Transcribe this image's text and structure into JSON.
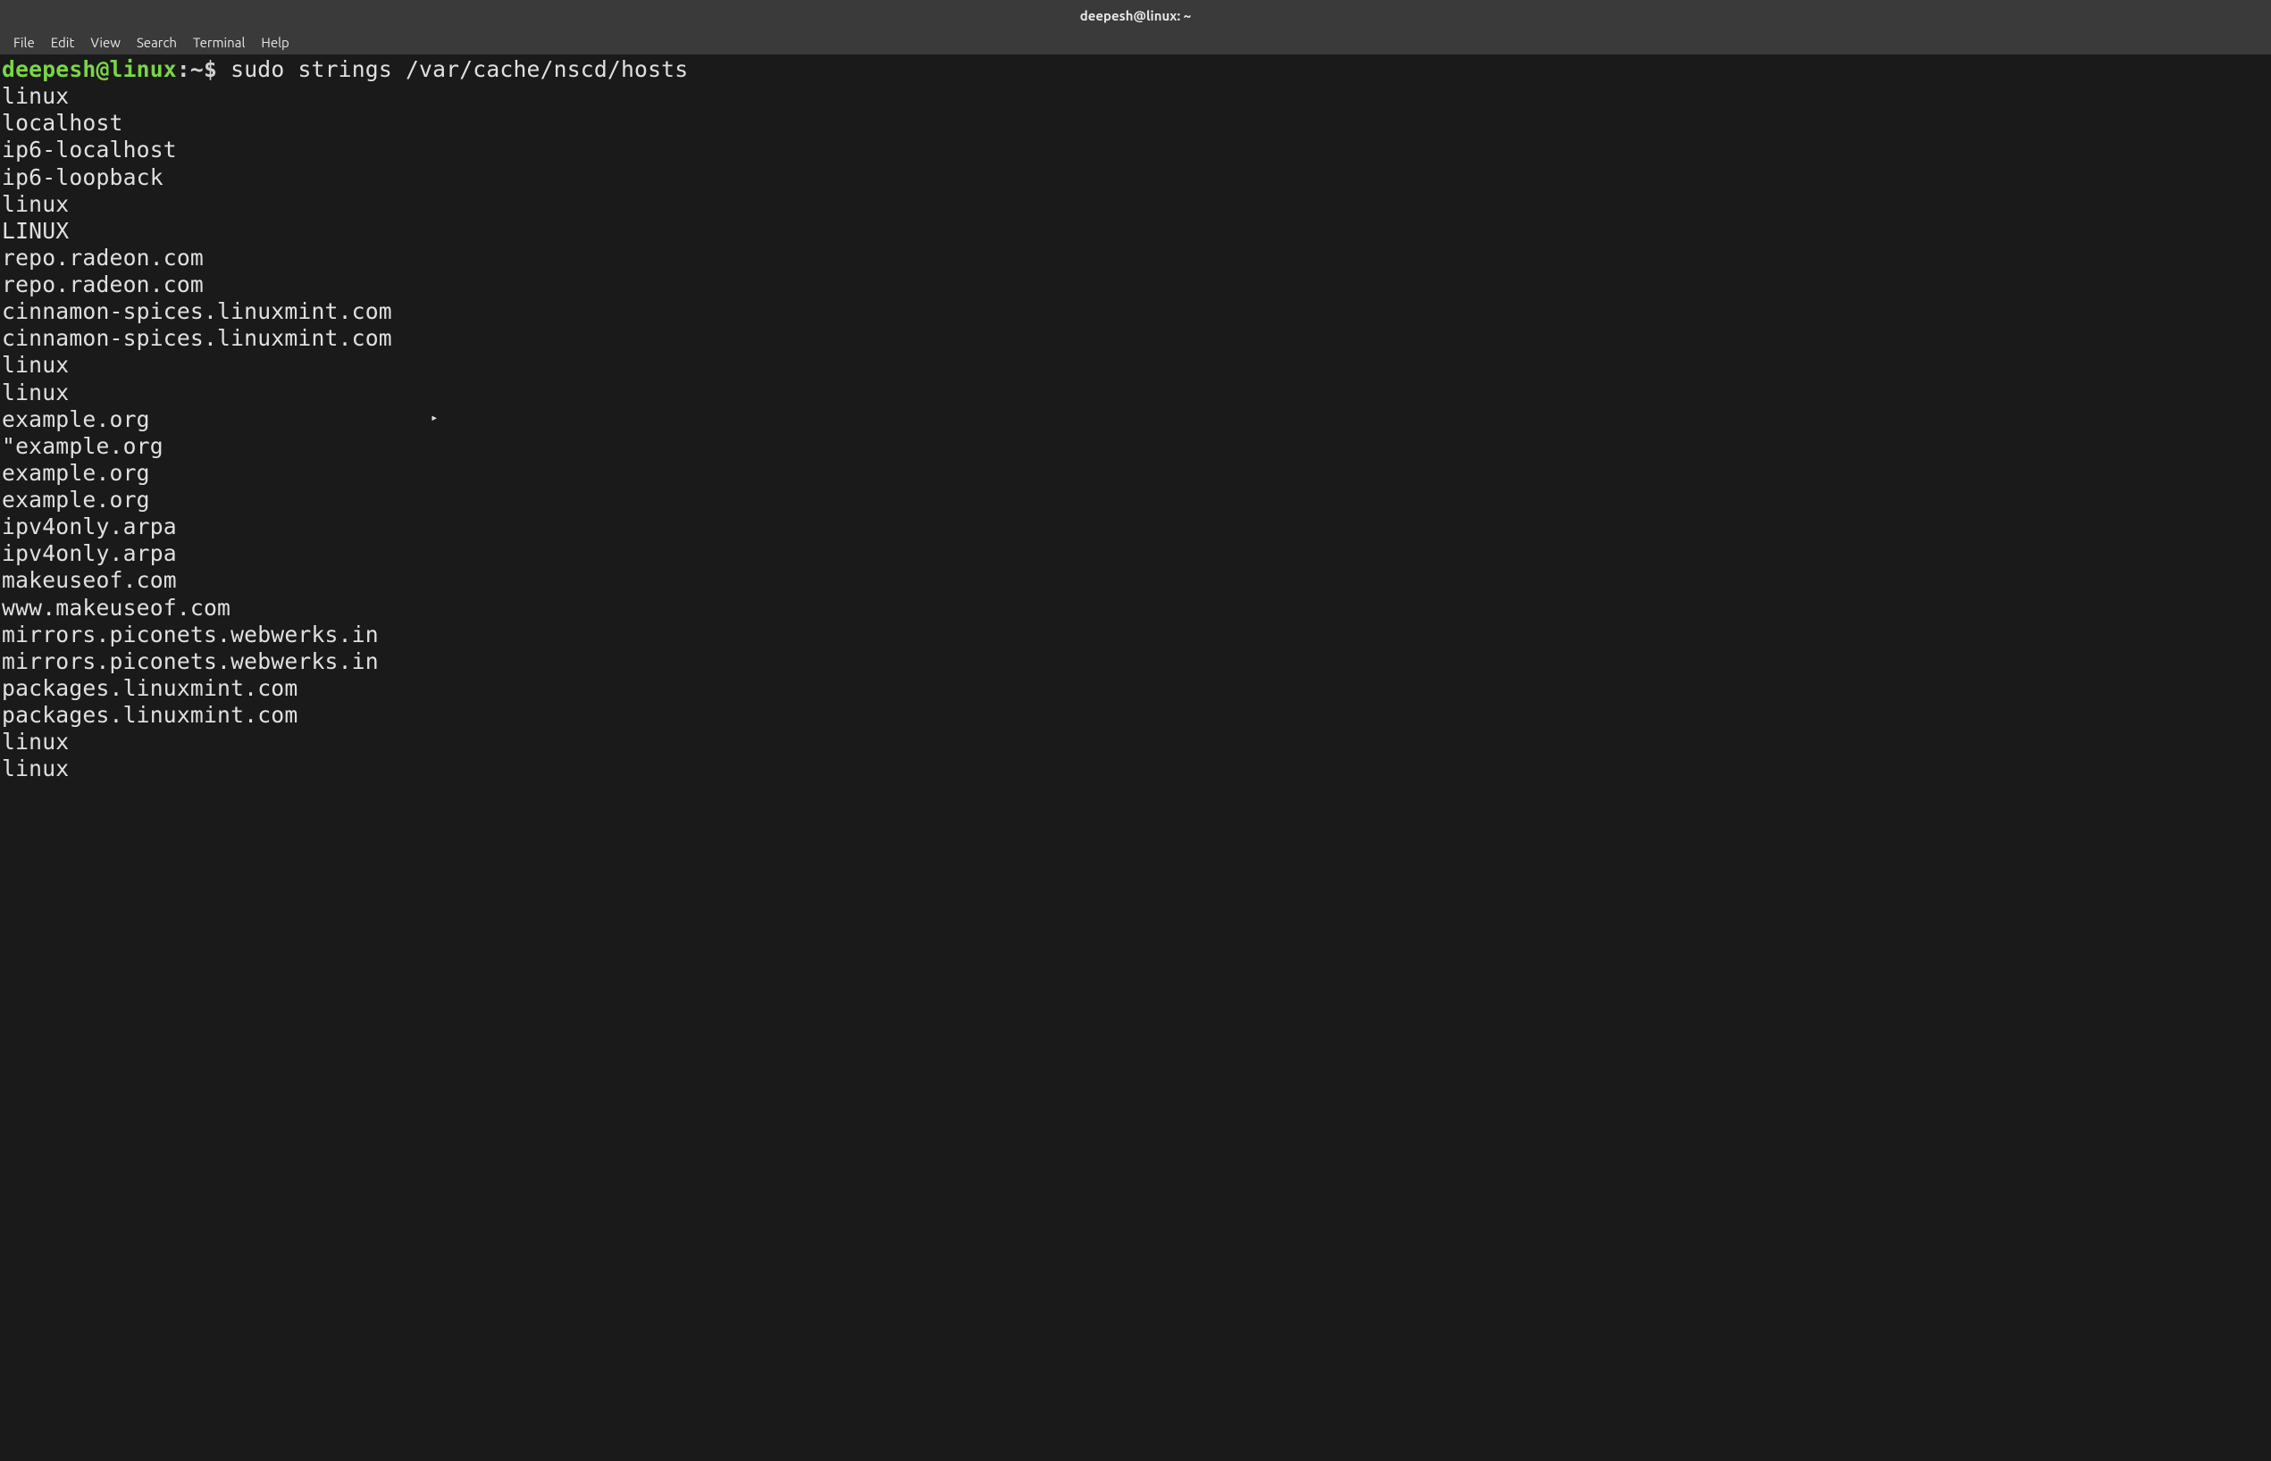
{
  "window": {
    "title": "deepesh@linux: ~"
  },
  "menubar": {
    "items": [
      "File",
      "Edit",
      "View",
      "Search",
      "Terminal",
      "Help"
    ]
  },
  "prompt": {
    "user_host": "deepesh@linux",
    "separator": ":",
    "path": "~",
    "symbol": "$"
  },
  "command": "sudo strings /var/cache/nscd/hosts",
  "output_lines": [
    "linux",
    "localhost",
    "ip6-localhost",
    "ip6-loopback",
    "linux",
    "LINUX",
    "repo.radeon.com",
    "repo.radeon.com",
    "cinnamon-spices.linuxmint.com",
    "cinnamon-spices.linuxmint.com",
    "linux",
    "linux",
    "example.org",
    "\"example.org",
    "example.org",
    "example.org",
    "ipv4only.arpa",
    "ipv4only.arpa",
    "makeuseof.com",
    "www.makeuseof.com",
    "mirrors.piconets.webwerks.in",
    "mirrors.piconets.webwerks.in",
    "packages.linuxmint.com",
    "packages.linuxmint.com",
    "linux",
    "linux"
  ]
}
